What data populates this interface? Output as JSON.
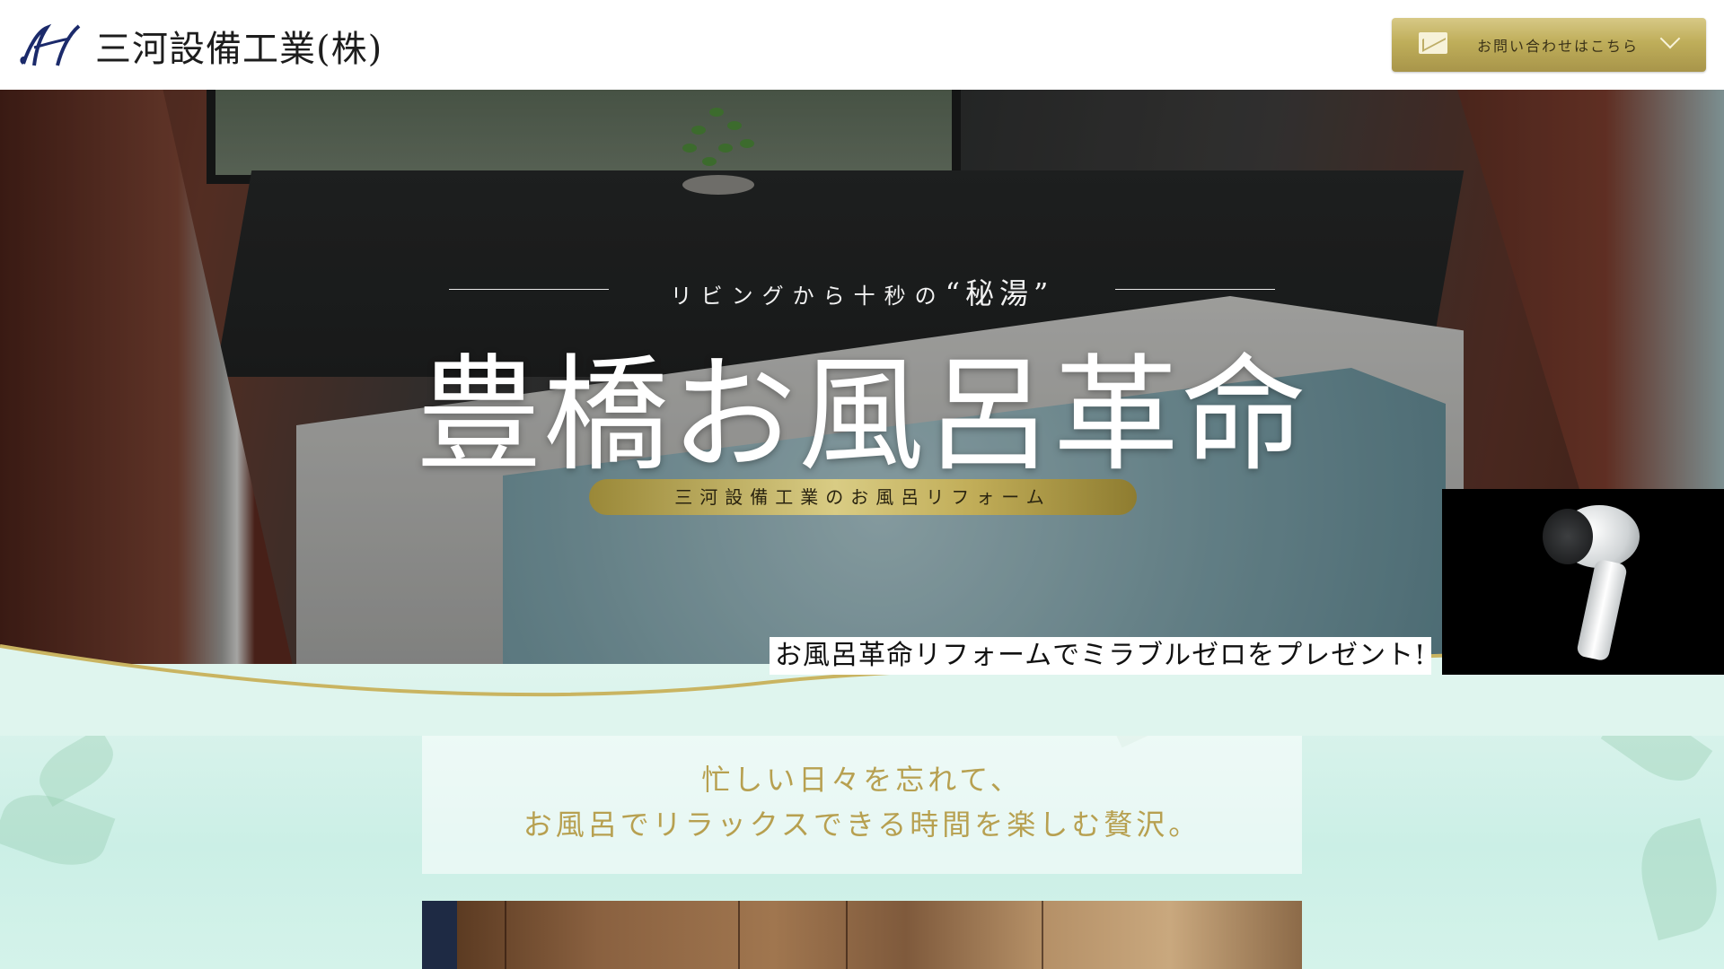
{
  "header": {
    "company_name": "三河設備工業(株)",
    "contact_label": "お問い合わせはこちら",
    "icons": {
      "mail": "mail-icon",
      "chevron": "chevron-down-icon"
    }
  },
  "hero": {
    "tagline_prefix": "リビングから十秒の",
    "tagline_highlight": "“秘湯”",
    "title": "豊橋お風呂革命",
    "subtitle": "三河設備工業のお風呂リフォーム",
    "promo": "お風呂革命リフォームでミラブルゼロをプレゼント!"
  },
  "intro": {
    "line1": "忙しい日々を忘れて、",
    "line2": "お風呂でリラックスできる時間を楽しむ贅沢。"
  },
  "colors": {
    "gold": "#c1ad58",
    "mint": "#dff5ee",
    "quote_text": "#b7a050"
  }
}
